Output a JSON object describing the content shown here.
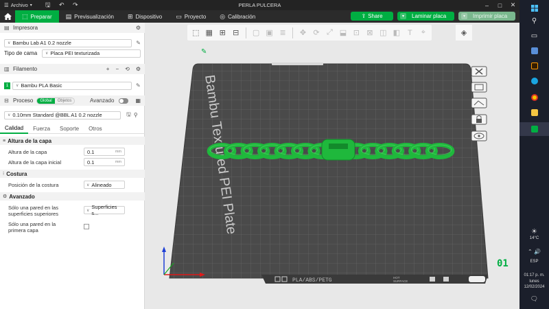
{
  "window": {
    "title": "PERLA PULCERA",
    "menu_label": "Archivo"
  },
  "nav": {
    "tabs": [
      {
        "label": "Preparar",
        "active": true
      },
      {
        "label": "Previsualización",
        "active": false
      },
      {
        "label": "Dispositivo",
        "active": false
      },
      {
        "label": "Proyecto",
        "active": false
      },
      {
        "label": "Calibración",
        "active": false
      }
    ],
    "share_label": "Share",
    "slice_label": "Laminar placa",
    "print_label": "Imprimir placa"
  },
  "printer": {
    "section_title": "Impresora",
    "printer_name": "Bambu Lab A1 0.2 nozzle",
    "bed_type_label": "Tipo de cama",
    "bed_type_value": "Placa PEI texturizada"
  },
  "filament": {
    "section_title": "Filamento",
    "slot_number": "1",
    "name": "Bambu PLA Basic"
  },
  "process": {
    "section_title": "Proceso",
    "global_label": "Global",
    "objects_label": "Objetos",
    "advanced_label": "Avanzado",
    "profile": "0.10mm Standard @BBL A1 0.2 nozzle",
    "tabs": [
      "Calidad",
      "Fuerza",
      "Soporte",
      "Otros"
    ],
    "groups": {
      "layer_height": {
        "title": "Altura de la capa",
        "layer_height_label": "Altura de la capa",
        "layer_height_value": "0.1",
        "initial_layer_label": "Altura de la capa inicial",
        "initial_layer_value": "0.1",
        "unit": "mm"
      },
      "seam": {
        "title": "Costura",
        "position_label": "Posición de la costura",
        "position_value": "Alineado"
      },
      "advanced": {
        "title": "Avanzado",
        "single_wall_top_label_1": "Sólo una pared en las",
        "single_wall_top_label_2": "superficies superiores",
        "single_wall_top_value": "Superficies s...",
        "single_wall_first_label_1": "Sólo una pared en la",
        "single_wall_first_label_2": "primera capa"
      }
    }
  },
  "viewport": {
    "bed_text": "Bambu Textured PEI Plate",
    "plate_filament": "PLA/ABS/PETG",
    "plate_surface_1": "HOT",
    "plate_surface_2": "SURFACE",
    "plate_number": "01",
    "model_color": "#1fb83c",
    "bed_color": "#4a4a4a",
    "grid_color": "#6a6a6a"
  },
  "taskbar": {
    "temperature": "14°C",
    "language": "ESP",
    "time": "01:17 p. m.",
    "day": "lunes",
    "date": "12/02/2024"
  },
  "colors": {
    "accent": "#00ae42",
    "titlebar": "#232323",
    "navbar": "#2b2b2b"
  }
}
